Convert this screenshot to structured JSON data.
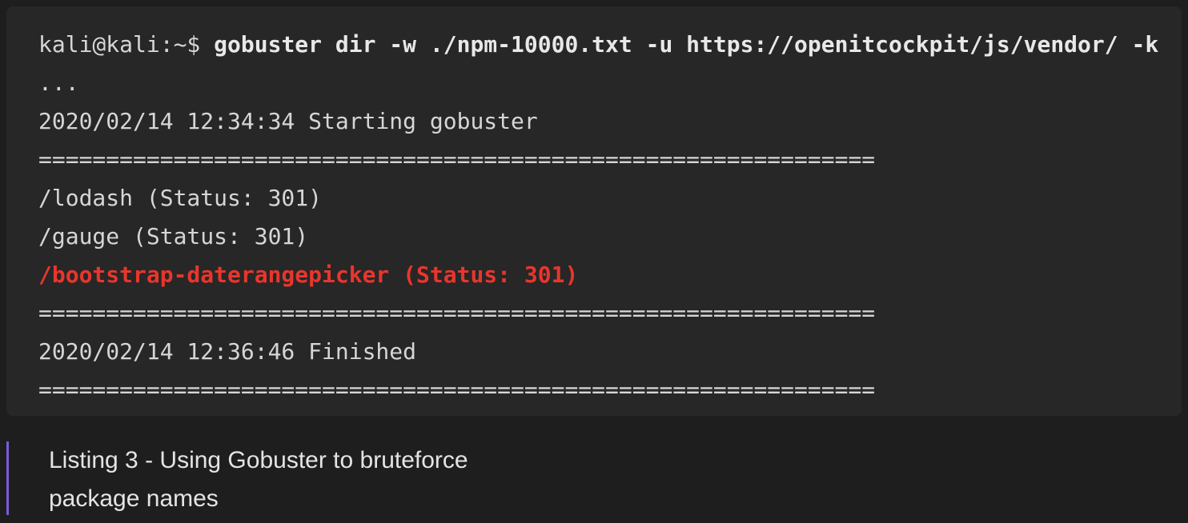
{
  "terminal": {
    "prompt": "kali@kali:~$ ",
    "command": "gobuster dir -w ./npm-10000.txt -u https://openitcockpit/js/vendor/ -k",
    "ellipsis": "...",
    "start_line": "2020/02/14 12:34:34 Starting gobuster",
    "separator": "==============================================================",
    "results": [
      "/lodash (Status: 301)",
      "/gauge (Status: 301)"
    ],
    "highlighted_result": "/bootstrap-daterangepicker (Status: 301)",
    "finish_line": "2020/02/14 12:36:46 Finished"
  },
  "caption": {
    "line1": "Listing 3 - Using Gobuster to bruteforce",
    "line2": "package names"
  },
  "colors": {
    "highlight": "#e8362d",
    "accent_bar": "#7b5cd6"
  }
}
